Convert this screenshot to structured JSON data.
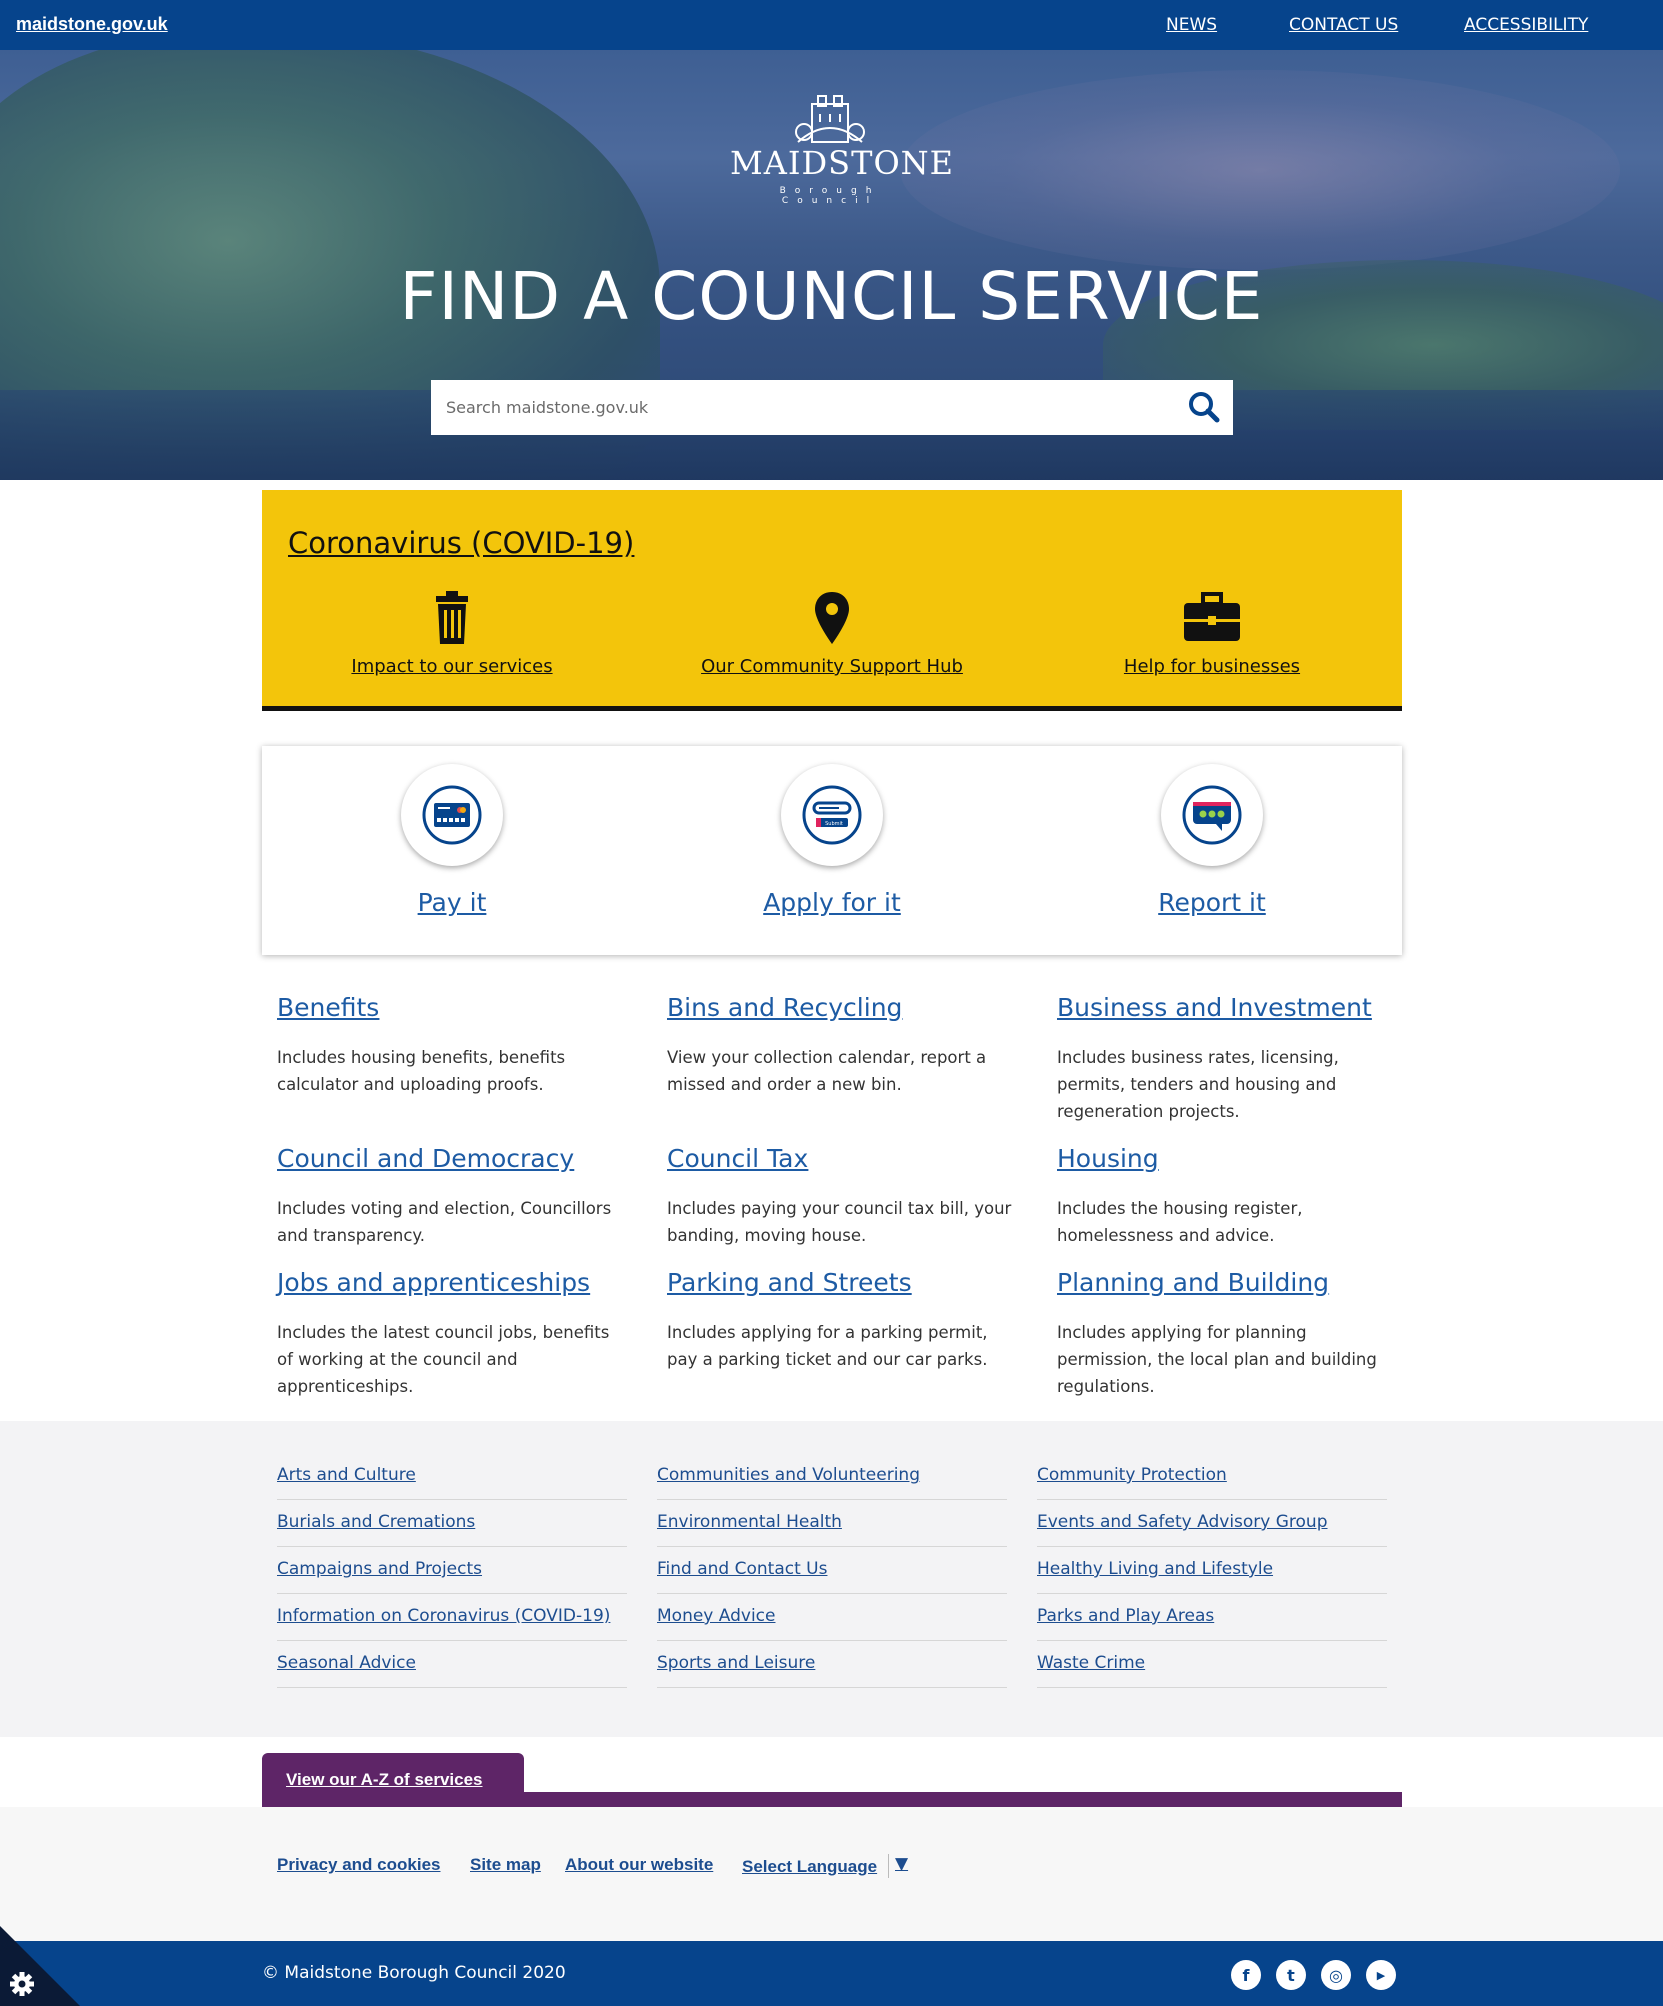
{
  "topbar": {
    "site": "maidstone.gov.uk",
    "nav": [
      "NEWS",
      "CONTACT US",
      "ACCESSIBILITY"
    ]
  },
  "logo": {
    "name": "MAIDSTONE",
    "sub": "Borough Council"
  },
  "hero": {
    "title": "FIND A COUNCIL SERVICE"
  },
  "search": {
    "placeholder": "Search maidstone.gov.uk",
    "icon": "search-icon"
  },
  "covid": {
    "title": "Coronavirus (COVID-19)",
    "items": [
      {
        "label": "Impact to our services",
        "icon": "trash-icon"
      },
      {
        "label": "Our Community Support Hub",
        "icon": "map-pin-icon"
      },
      {
        "label": "Help for businesses",
        "icon": "briefcase-icon"
      }
    ]
  },
  "actions": [
    {
      "label": "Pay it",
      "icon": "credit-card-icon"
    },
    {
      "label": "Apply for it",
      "icon": "form-submit-icon",
      "icon_text": "Submit"
    },
    {
      "label": "Report it",
      "icon": "speech-bubble-icon"
    }
  ],
  "services": [
    {
      "title": "Benefits",
      "desc": "Includes housing benefits, benefits calculator and uploading proofs."
    },
    {
      "title": "Bins and Recycling",
      "desc": "View your collection calendar, report a missed and order a new bin."
    },
    {
      "title": "Business and Investment",
      "desc": "Includes business rates, licensing, permits, tenders and housing and regeneration projects."
    },
    {
      "title": "Council and Democracy",
      "desc": "Includes voting and election, Councillors and transparency."
    },
    {
      "title": "Council Tax",
      "desc": "Includes paying your council tax bill, your banding, moving house."
    },
    {
      "title": "Housing",
      "desc": "Includes the housing register, homelessness and advice."
    },
    {
      "title": "Jobs and apprenticeships",
      "desc": "Includes the latest council jobs, benefits of working at the council and apprenticeships."
    },
    {
      "title": "Parking and Streets",
      "desc": "Includes applying for a parking permit, pay a parking ticket and our car parks."
    },
    {
      "title": "Planning and Building",
      "desc": "Includes applying for planning permission, the local plan and building regulations."
    }
  ],
  "links": [
    [
      "Arts and Culture",
      "Burials and Cremations",
      "Campaigns and Projects",
      "Information on Coronavirus (COVID-19)",
      "Seasonal Advice"
    ],
    [
      "Communities and Volunteering",
      "Environmental Health",
      "Find and Contact Us",
      "Money Advice",
      "Sports and Leisure"
    ],
    [
      "Community Protection",
      "Events and Safety Advisory Group",
      "Healthy Living and Lifestyle",
      "Parks and Play Areas",
      "Waste Crime"
    ]
  ],
  "az": {
    "label": "View our A-Z of services"
  },
  "footer": {
    "links": [
      "Privacy and cookies",
      "Site map",
      "About our website"
    ],
    "language": "Select Language",
    "language_arrow": "▼",
    "copyright": "© Maidstone Borough Council 2020",
    "social": [
      {
        "icon": "facebook-icon",
        "glyph": "f"
      },
      {
        "icon": "twitter-icon",
        "glyph": "t"
      },
      {
        "icon": "instagram-icon",
        "glyph": "◎"
      },
      {
        "icon": "youtube-icon",
        "glyph": "▶"
      }
    ]
  },
  "colors": {
    "brand_blue": "#06448c",
    "link_blue": "#1d5ba4",
    "covid_yellow": "#f3c50b",
    "az_purple": "#5e2567"
  }
}
